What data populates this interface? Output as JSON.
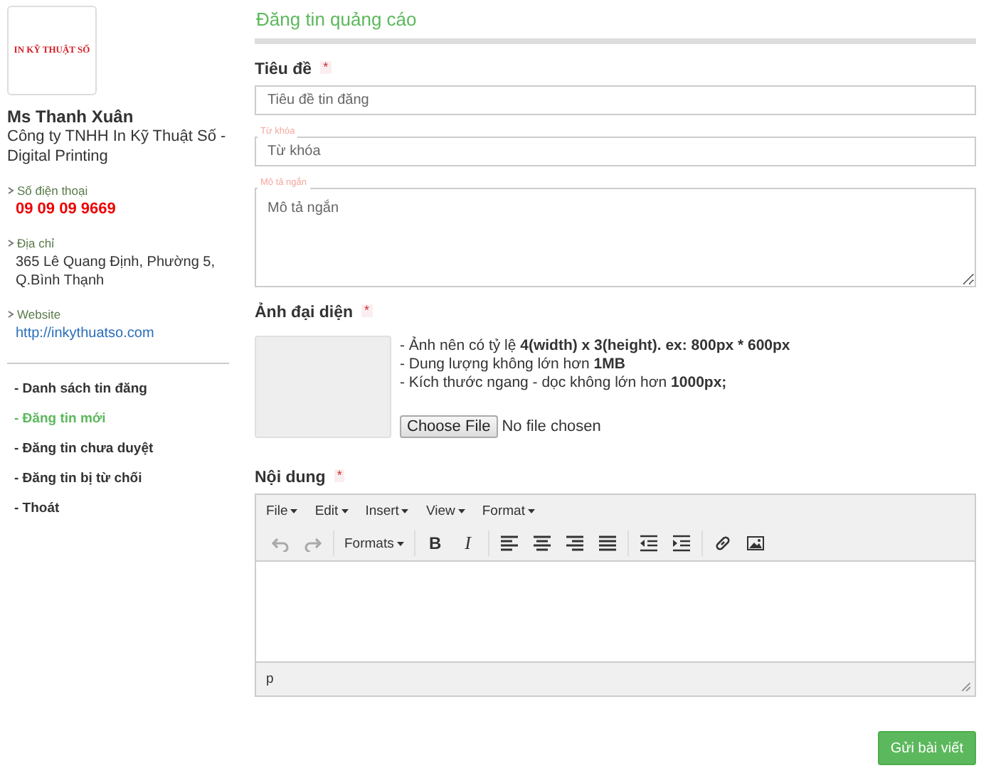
{
  "sidebar": {
    "logo": {
      "text": "IN KỸ THUẬT SỐ"
    },
    "name": "Ms Thanh Xuân",
    "company": "Công ty TNHH In Kỹ Thuật Số - Digital Printing",
    "contacts": [
      {
        "kind": "phone",
        "label": "Số điện thoại",
        "value": "09 09 09 9669"
      },
      {
        "kind": "text",
        "label": "Địa chỉ",
        "value": "365 Lê Quang Định, Phường 5, Q.Bình Thạnh"
      },
      {
        "kind": "link",
        "label": "Website",
        "value": "http://inkythuatso.com"
      }
    ],
    "menu": [
      {
        "label": "- Danh sách tin đăng",
        "selected": false
      },
      {
        "label": "- Đăng tin mới",
        "selected": true
      },
      {
        "label": "- Đăng tin chưa duyệt",
        "selected": false
      },
      {
        "label": "- Đăng tin bị từ chối",
        "selected": false
      },
      {
        "label": "- Thoát",
        "selected": false
      }
    ]
  },
  "form": {
    "title": "Đăng tin quảng cáo",
    "title_field": {
      "label": "Tiêu đề",
      "required_mark": "*",
      "placeholder": "Tiêu đề tin đăng"
    },
    "keyword_field": {
      "floating_label": "Từ khóa",
      "placeholder": "Từ khóa"
    },
    "description_field": {
      "floating_label": "Mô tả ngắn",
      "placeholder": "Mô tả ngắn"
    },
    "image": {
      "label": "Ảnh đại diện",
      "required_mark": "*",
      "notes": [
        "- Ảnh nên có tỷ lệ **4(width) x 3(height). ex: 800px * 600px**",
        "- Dung lượng không lớn hơn **1MB**",
        "- Kích thước ngang - dọc không lớn hơn **1000px;**"
      ],
      "file_button": "Choose File",
      "file_status": "No file chosen"
    },
    "content": {
      "label": "Nội dung",
      "required_mark": "*",
      "menus": [
        "File",
        "Edit",
        "Insert",
        "View",
        "Format"
      ],
      "toolbar": [
        [
          {
            "kind": "undo",
            "disabled": true
          },
          {
            "kind": "redo",
            "disabled": true
          }
        ],
        [
          {
            "kind": "dropdown",
            "label": "Formats",
            "disabled": false
          }
        ],
        [
          {
            "kind": "bold",
            "label": "B",
            "disabled": false
          },
          {
            "kind": "italic",
            "label": "I",
            "disabled": false
          }
        ],
        [
          {
            "kind": "align-left",
            "disabled": false
          },
          {
            "kind": "align-center",
            "disabled": false
          },
          {
            "kind": "align-right",
            "disabled": false
          },
          {
            "kind": "justify",
            "disabled": false
          }
        ],
        [
          {
            "kind": "outdent",
            "disabled": false
          },
          {
            "kind": "indent",
            "disabled": false
          }
        ],
        [
          {
            "kind": "link",
            "disabled": false
          },
          {
            "kind": "image",
            "disabled": false
          }
        ]
      ],
      "status_path": "p"
    },
    "submit": "Gửi bài viết"
  }
}
